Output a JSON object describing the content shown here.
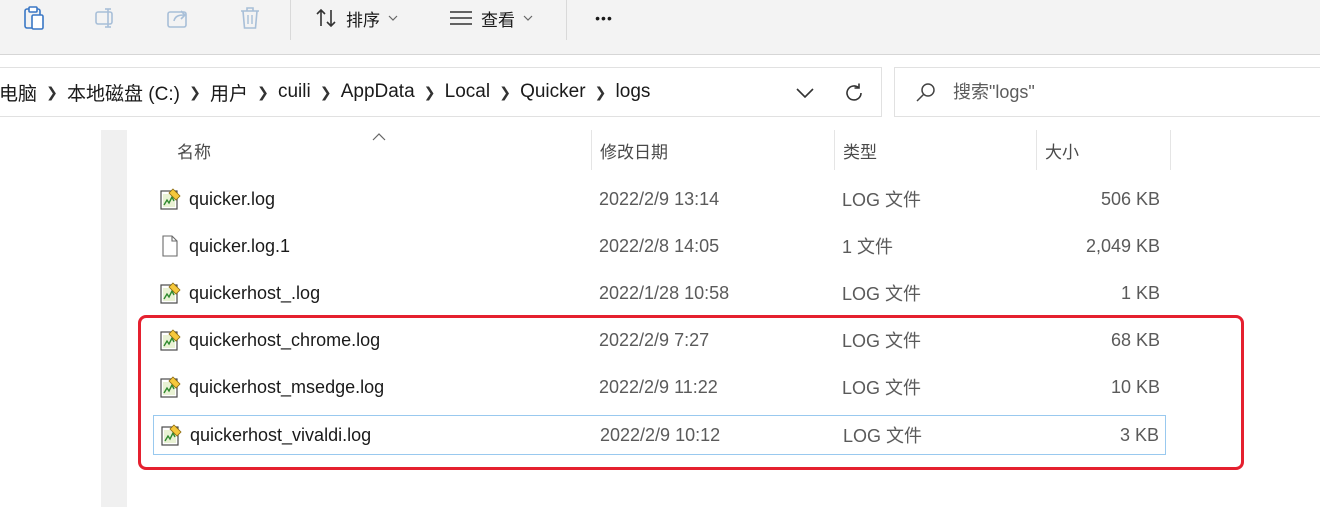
{
  "toolbar": {
    "sort_label": "排序",
    "view_label": "查看",
    "more_label": "•••"
  },
  "address": {
    "crumbs": [
      "电脑",
      "本地磁盘 (C:)",
      "用户",
      "cuili",
      "AppData",
      "Local",
      "Quicker",
      "logs"
    ]
  },
  "search": {
    "placeholder": "搜索\"logs\""
  },
  "columns": {
    "name": "名称",
    "date": "修改日期",
    "type": "类型",
    "size": "大小"
  },
  "files": [
    {
      "name": "quicker.log",
      "date": "2022/2/9 13:14",
      "type": "LOG 文件",
      "size": "506 KB",
      "icon": "log-file-icon"
    },
    {
      "name": "quicker.log.1",
      "date": "2022/2/8 14:05",
      "type": "1 文件",
      "size": "2,049 KB",
      "icon": "blank-file-icon"
    },
    {
      "name": "quickerhost_.log",
      "date": "2022/1/28 10:58",
      "type": "LOG 文件",
      "size": "1 KB",
      "icon": "log-file-icon"
    },
    {
      "name": "quickerhost_chrome.log",
      "date": "2022/2/9 7:27",
      "type": "LOG 文件",
      "size": "68 KB",
      "icon": "log-file-icon"
    },
    {
      "name": "quickerhost_msedge.log",
      "date": "2022/2/9 11:22",
      "type": "LOG 文件",
      "size": "10 KB",
      "icon": "log-file-icon"
    },
    {
      "name": "quickerhost_vivaldi.log",
      "date": "2022/2/9 10:12",
      "type": "LOG 文件",
      "size": "3 KB",
      "icon": "log-file-icon"
    }
  ],
  "colors": {
    "highlight": "#e5202f",
    "selection_border": "#99c9ef",
    "toolbar_bg": "#f3f3f3"
  }
}
